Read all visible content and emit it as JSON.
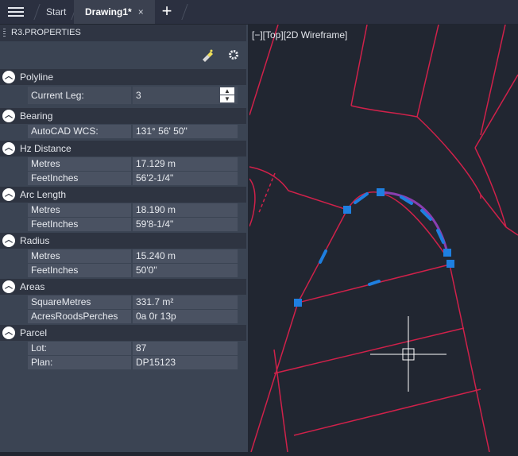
{
  "tabs": {
    "start": "Start",
    "active": "Drawing1*",
    "close_glyph": "×",
    "new_glyph": "+"
  },
  "panel": {
    "title": "R3.PROPERTIES",
    "sections": [
      {
        "title": "Polyline",
        "rows": [
          {
            "key": "Current Leg:",
            "value": "3"
          }
        ]
      },
      {
        "title": "Bearing",
        "rows": [
          {
            "key": "AutoCAD WCS:",
            "value": "131° 56' 50\""
          }
        ]
      },
      {
        "title": "Hz Distance",
        "rows": [
          {
            "key": "Metres",
            "value": "17.129 m"
          },
          {
            "key": "FeetInches",
            "value": "56'2-1/4\""
          }
        ]
      },
      {
        "title": "Arc Length",
        "rows": [
          {
            "key": "Metres",
            "value": "18.190 m"
          },
          {
            "key": "FeetInches",
            "value": "59'8-1/4\""
          }
        ]
      },
      {
        "title": "Radius",
        "rows": [
          {
            "key": "Metres",
            "value": "15.240 m"
          },
          {
            "key": "FeetInches",
            "value": "50'0\""
          }
        ]
      },
      {
        "title": "Areas",
        "rows": [
          {
            "key": "SquareMetres",
            "value": "331.7 m²"
          },
          {
            "key": "AcresRoodsPerches",
            "value": "0a 0r 13p"
          }
        ]
      },
      {
        "title": "Parcel",
        "rows": [
          {
            "key": "Lot:",
            "value": "87"
          },
          {
            "key": "Plan:",
            "value": "DP15123"
          }
        ]
      }
    ]
  },
  "viewport": {
    "label": "[−][Top][2D Wireframe]"
  },
  "colors": {
    "line_red": "#d0214a",
    "grip_blue": "#1e7fe0",
    "highlight": "#8a3fb0"
  }
}
